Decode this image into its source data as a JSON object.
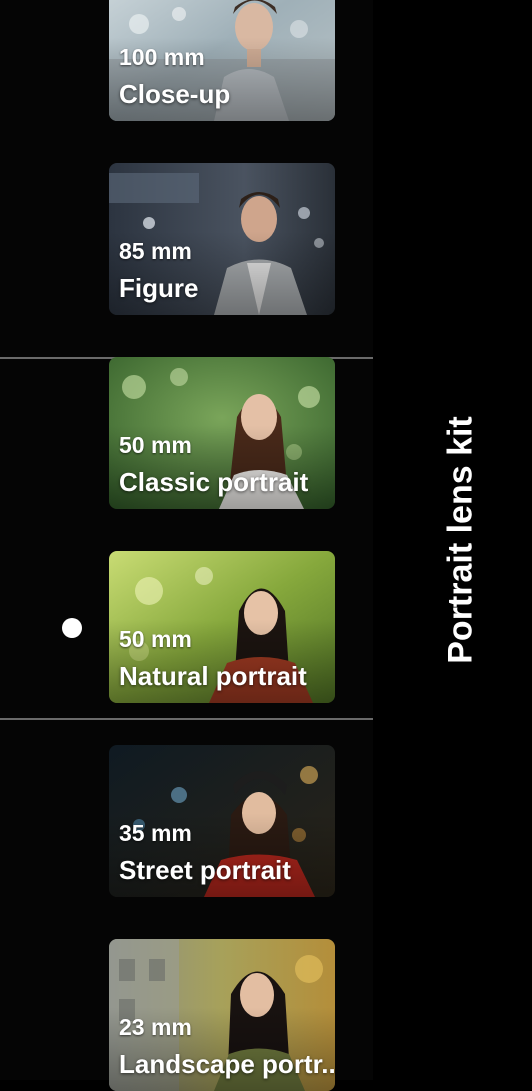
{
  "kit_title": "Portrait lens kit",
  "lenses": [
    {
      "focal": "100 mm",
      "mode": "Close-up"
    },
    {
      "focal": "85 mm",
      "mode": "Figure"
    },
    {
      "focal": "50 mm",
      "mode": "Classic portrait"
    },
    {
      "focal": "50 mm",
      "mode": "Natural portrait"
    },
    {
      "focal": "35 mm",
      "mode": "Street portrait"
    },
    {
      "focal": "23 mm",
      "mode": "Landscape portr.."
    }
  ],
  "selected_index": 3,
  "colors": {
    "background": "#000000",
    "text": "#ffffff",
    "divider": "#6b6b6b",
    "selected_dot": "#ffffff"
  }
}
